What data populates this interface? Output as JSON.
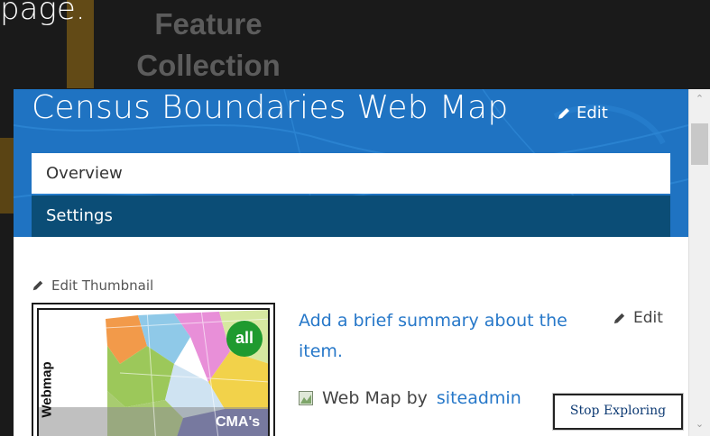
{
  "background": {
    "page_text": "page.",
    "feature_collection_line1": "Feature",
    "feature_collection_line2": "Collection"
  },
  "header": {
    "title": "Census Boundaries Web Map",
    "edit_label": "Edit",
    "accent": "#1f73c2"
  },
  "tabs": [
    {
      "label": "Overview",
      "selected": false
    },
    {
      "label": "Settings",
      "selected": true
    }
  ],
  "thumbnail": {
    "edit_label": "Edit Thumbnail",
    "side_label": "Webmap",
    "badge": "all",
    "corner_label": "CMA's"
  },
  "summary": {
    "text": "Add a brief summary about the item.",
    "edit_label": "Edit"
  },
  "item_info": {
    "type_prefix": "Web Map by",
    "owner": "siteadmin",
    "icon": "web-map-icon"
  },
  "stop_button": {
    "label": "Stop Exploring"
  },
  "scrollbar": {
    "up_icon": "scroll-up-arrow",
    "down_icon": "scroll-down-arrow"
  }
}
